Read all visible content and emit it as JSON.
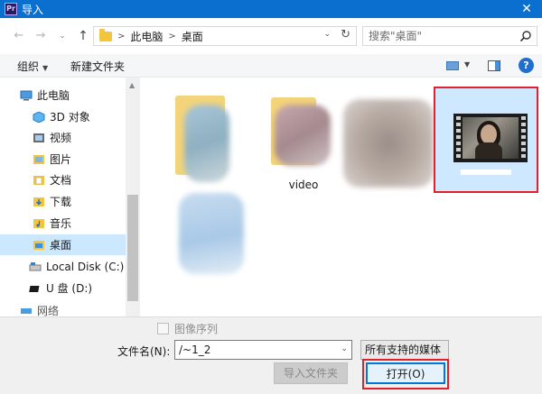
{
  "window": {
    "title": "导入",
    "app_badge": "Pr",
    "close": "✕"
  },
  "nav": {
    "back": "←",
    "forward": "→",
    "recent": "⌄",
    "up": "↑"
  },
  "address": {
    "crumbs": [
      "此电脑",
      "桌面"
    ],
    "separator": ">",
    "dropdown": "⌄",
    "refresh": "↻"
  },
  "search": {
    "placeholder": "搜索\"桌面\""
  },
  "toolbar": {
    "organize": "组织",
    "new_folder": "新建文件夹",
    "help": "?"
  },
  "tree": {
    "root": "此电脑",
    "items": [
      {
        "label": "3D 对象",
        "icon": "cube-icon"
      },
      {
        "label": "视频",
        "icon": "video-folder-icon"
      },
      {
        "label": "图片",
        "icon": "pictures-folder-icon"
      },
      {
        "label": "文档",
        "icon": "documents-folder-icon"
      },
      {
        "label": "下载",
        "icon": "download-folder-icon"
      },
      {
        "label": "音乐",
        "icon": "music-folder-icon"
      },
      {
        "label": "桌面",
        "icon": "desktop-folder-icon",
        "selected": true
      },
      {
        "label": "Local Disk (C:)",
        "icon": "disk-icon"
      },
      {
        "label": "U 盘 (D:)",
        "icon": "usb-drive-icon"
      }
    ],
    "partial": "网络"
  },
  "files": [
    {
      "name": ""
    },
    {
      "name": "video"
    },
    {
      "name": ""
    },
    {
      "name": "",
      "selected": true
    },
    {
      "name": ""
    }
  ],
  "bottom": {
    "sequence_label": "图像序列",
    "filename_label": "文件名(N):",
    "filename_value": "/~1_2",
    "filetype_value": "所有支持的媒体",
    "import_folder_btn": "导入文件夹",
    "open_btn": "打开(O)"
  },
  "colors": {
    "titlebar": "#0b6fd0",
    "selection": "#cce8ff",
    "highlight_box": "#e0212b",
    "accent": "#0078d7"
  }
}
